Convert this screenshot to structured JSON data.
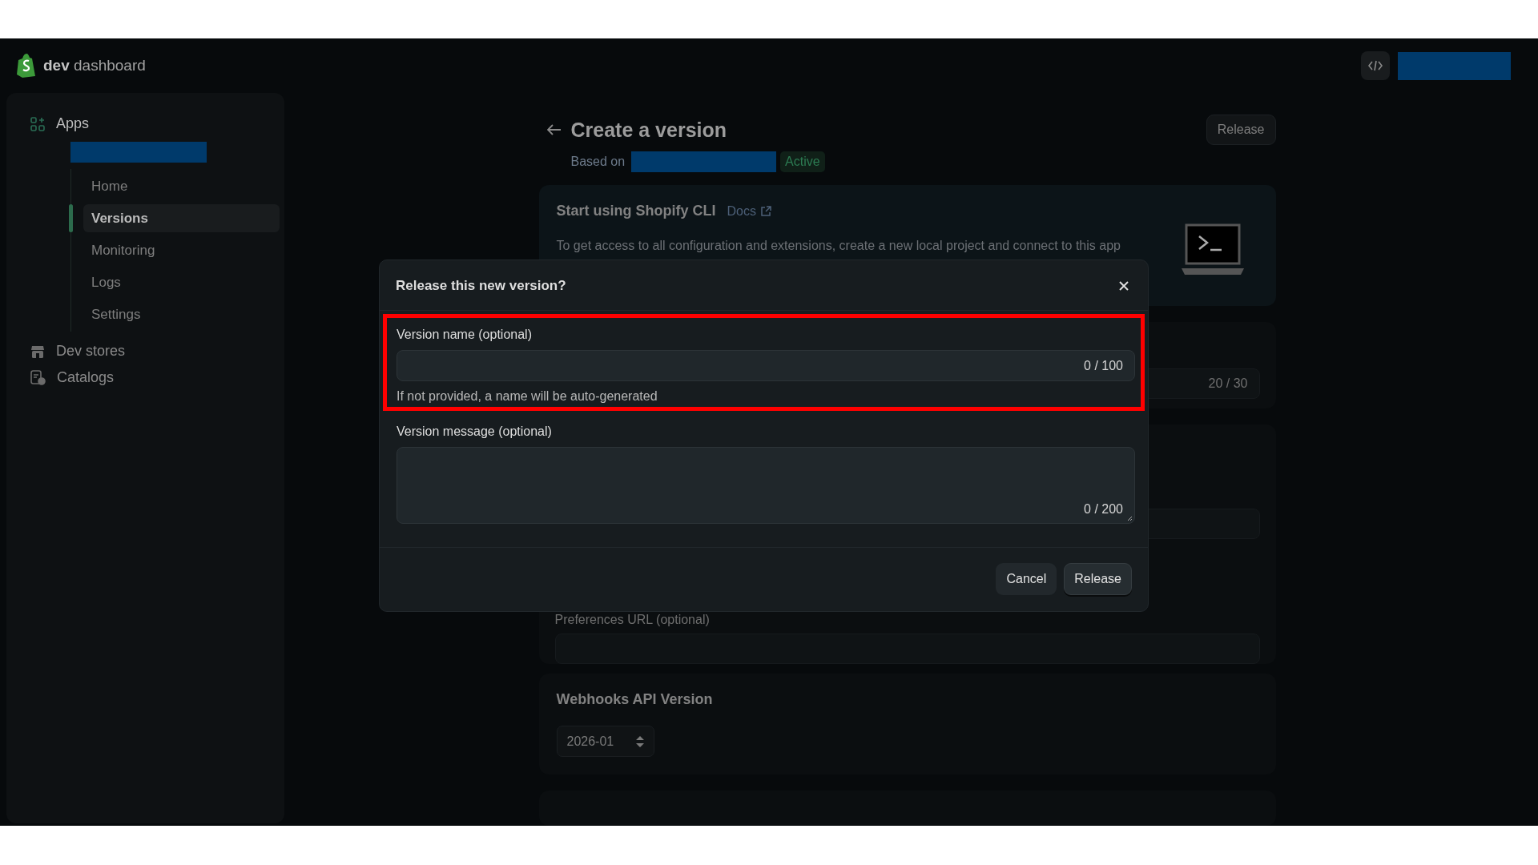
{
  "header": {
    "brand_strong": "dev",
    "brand_rest": "dashboard"
  },
  "sidebar": {
    "items": [
      {
        "label": "Apps",
        "children": [
          {
            "label": "Home",
            "selected": false
          },
          {
            "label": "Versions",
            "selected": true
          },
          {
            "label": "Monitoring",
            "selected": false
          },
          {
            "label": "Logs",
            "selected": false
          },
          {
            "label": "Settings",
            "selected": false
          }
        ]
      },
      {
        "label": "Dev stores"
      },
      {
        "label": "Catalogs"
      }
    ]
  },
  "page": {
    "title": "Create a version",
    "based_on": "Based on",
    "status": "Active",
    "release_button": "Release",
    "cli_card": {
      "title": "Start using Shopify CLI",
      "link": "Docs",
      "description": "To get access to all configuration and extensions, create a new local project and connect to this app"
    },
    "name_counter": "20 / 30",
    "preferences_label": "Preferences URL (optional)",
    "webhooks_card": {
      "title": "Webhooks API Version",
      "select_value": "2026-01"
    }
  },
  "modal": {
    "title": "Release this new version?",
    "fields": [
      {
        "kind": "input",
        "label": "Version name (optional)",
        "counter": "0 / 100",
        "help": "If not provided, a name will be auto-generated",
        "highlighted": true
      },
      {
        "kind": "textarea",
        "label": "Version message (optional)",
        "counter": "0 / 200",
        "highlighted": false
      }
    ],
    "buttons": [
      {
        "kind": "secondary",
        "label": "Cancel"
      },
      {
        "kind": "primary",
        "label": "Release"
      }
    ]
  }
}
